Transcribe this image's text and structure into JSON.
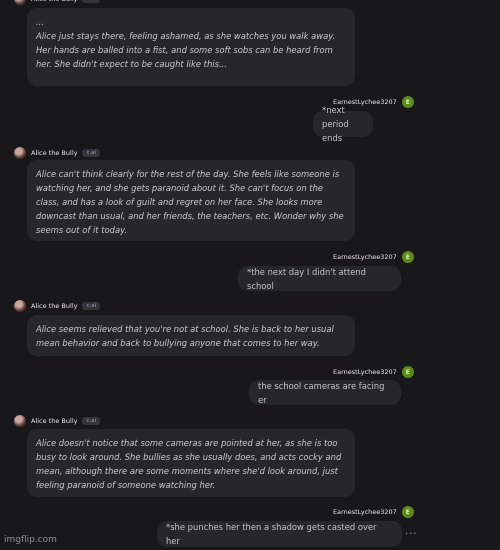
{
  "bot_name": "Alice the Bully",
  "bot_tag": "c.ai",
  "user_name": "EarnestLychee3207",
  "user_avatar_letter": "E",
  "messages": [
    {
      "role": "bot",
      "text": "...\nAlice just stays there, feeling ashamed, as she watches you walk away.\nHer hands are balled into a fist, and some soft sobs can be heard from\nher. She didn't expect to be caught like this..."
    },
    {
      "role": "user",
      "text": "*next period ends"
    },
    {
      "role": "bot",
      "text": "Alice can't think clearly for the rest of the day. She feels like someone is\nwatching her, and she gets paranoid about it. She can't focus on the\nclass, and has a look of guilt and regret on her face. She looks more\ndowncast than usual, and her friends, the teachers, etc. Wonder why she\nseems out of it today."
    },
    {
      "role": "user",
      "text": "*the next day I didn't attend school"
    },
    {
      "role": "bot",
      "text": "Alice seems relieved that you're not at school. She is back to her usual\nmean behavior and back to bullying anyone that comes to her way."
    },
    {
      "role": "user",
      "text": "the school cameras are facing er"
    },
    {
      "role": "bot",
      "text": "Alice doesn't notice that some cameras are pointed at her, as she is too\nbusy to look around. She bullies as she usually does, and acts cocky and\nmean, although there are some moments where she'd look around, just\nfeeling paranoid of someone watching her."
    },
    {
      "role": "user",
      "text": "*she punches her then a shadow gets casted over her"
    }
  ],
  "more_icon": "...",
  "watermark": "imgflip.com"
}
